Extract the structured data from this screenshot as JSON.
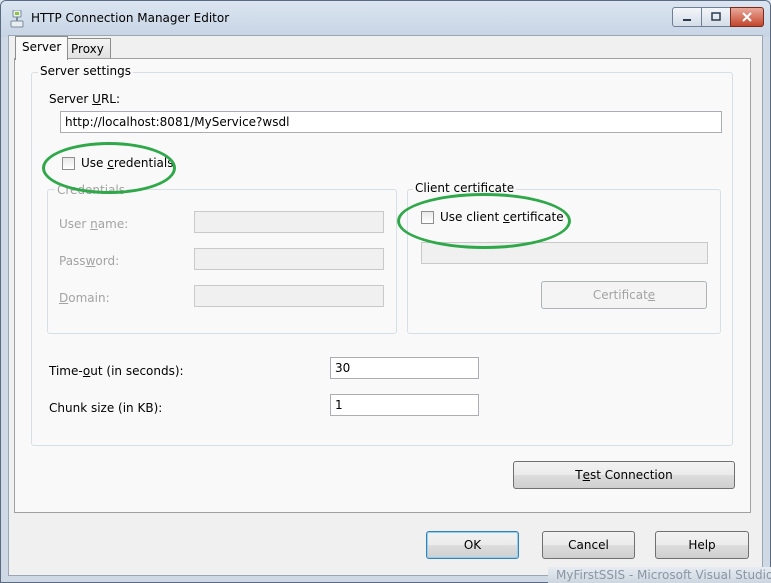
{
  "window": {
    "title": "HTTP Connection Manager Editor"
  },
  "tabs": [
    {
      "label": "Server",
      "active": true
    },
    {
      "label": "Proxy",
      "active": false
    }
  ],
  "server_settings": {
    "group_label": "Server settings",
    "server_url": {
      "label_pre": "Server ",
      "label_mn": "U",
      "label_post": "RL:",
      "value": "http://localhost:8081/MyService?wsdl"
    },
    "use_credentials": {
      "label_pre": "Use ",
      "label_mn": "c",
      "label_post": "redentials",
      "checked": false
    },
    "credentials": {
      "group_label": "Credentials",
      "user_name": {
        "label_pre": "User ",
        "label_mn": "n",
        "label_post": "ame:",
        "value": ""
      },
      "password": {
        "label_pre": "Pass",
        "label_mn": "w",
        "label_post": "ord:",
        "value": ""
      },
      "domain": {
        "label_pre": "",
        "label_mn": "D",
        "label_post": "omain:",
        "value": ""
      }
    },
    "client_certificate": {
      "group_label": "Client certificate",
      "use_label_pre": "Use client ",
      "use_label_mn": "c",
      "use_label_post": "ertificate",
      "checked": false,
      "value": "",
      "button_pre": "Certificat",
      "button_mn": "e",
      "button_post": ""
    },
    "timeout": {
      "label_pre": "Time-",
      "label_mn": "o",
      "label_post": "ut (in seconds):",
      "value": "30"
    },
    "chunk_size": {
      "label": "Chunk size (in KB):",
      "value": "1"
    }
  },
  "buttons": {
    "test_pre": "T",
    "test_mn": "e",
    "test_post": "st Connection",
    "ok": "OK",
    "cancel": "Cancel",
    "help": "Help"
  },
  "taskbar": {
    "text": "MyFirstSSIS - Microsoft Visual Studio"
  },
  "colors": {
    "annotation_circle": "#2fa84a"
  }
}
